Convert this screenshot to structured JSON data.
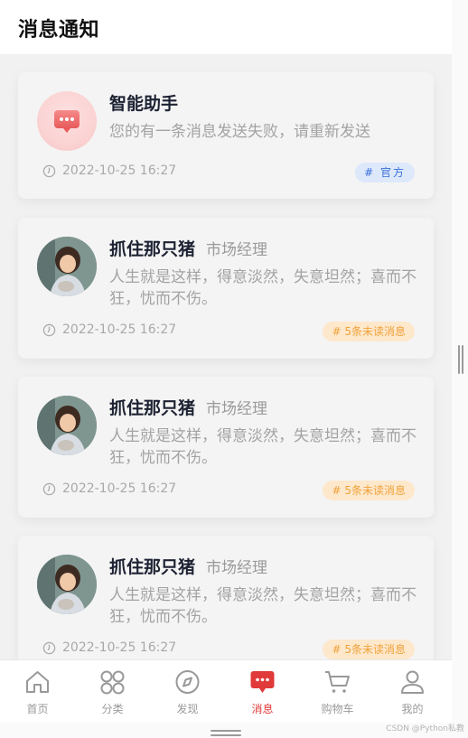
{
  "header": {
    "title": "消息通知"
  },
  "cards": [
    {
      "title": "智能助手",
      "role": "",
      "desc": "您的有一条消息发送失败，请重新发送",
      "time": "2022-10-25 16:27",
      "badge": "# 官方",
      "badge_color": "#3a6fd8"
    },
    {
      "title": "抓住那只猪",
      "role": "市场经理",
      "desc": "人生就是这样，得意淡然，失意坦然；喜而不狂，忧而不伤。",
      "time": "2022-10-25 16:27",
      "badge": "# 5条未读消息",
      "badge_color": "#f0a23a"
    },
    {
      "title": "抓住那只猪",
      "role": "市场经理",
      "desc": "人生就是这样，得意淡然，失意坦然；喜而不狂，忧而不伤。",
      "time": "2022-10-25 16:27",
      "badge": "# 5条未读消息",
      "badge_color": "#f0a23a"
    },
    {
      "title": "抓住那只猪",
      "role": "市场经理",
      "desc": "人生就是这样，得意淡然，失意坦然；喜而不狂，忧而不伤。",
      "time": "2022-10-25 16:27",
      "badge": "# 5条未读消息",
      "badge_color": "#f0a23a"
    }
  ],
  "tabs": [
    {
      "label": "首页",
      "icon": "home-icon"
    },
    {
      "label": "分类",
      "icon": "category-icon"
    },
    {
      "label": "发现",
      "icon": "compass-icon"
    },
    {
      "label": "消息",
      "icon": "message-icon",
      "active": true
    },
    {
      "label": "购物车",
      "icon": "cart-icon"
    },
    {
      "label": "我的",
      "icon": "user-icon"
    }
  ],
  "watermark": "CSDN @Python私教",
  "colors": {
    "accent": "#e03a3a",
    "inactive": "#9a9a9a"
  }
}
